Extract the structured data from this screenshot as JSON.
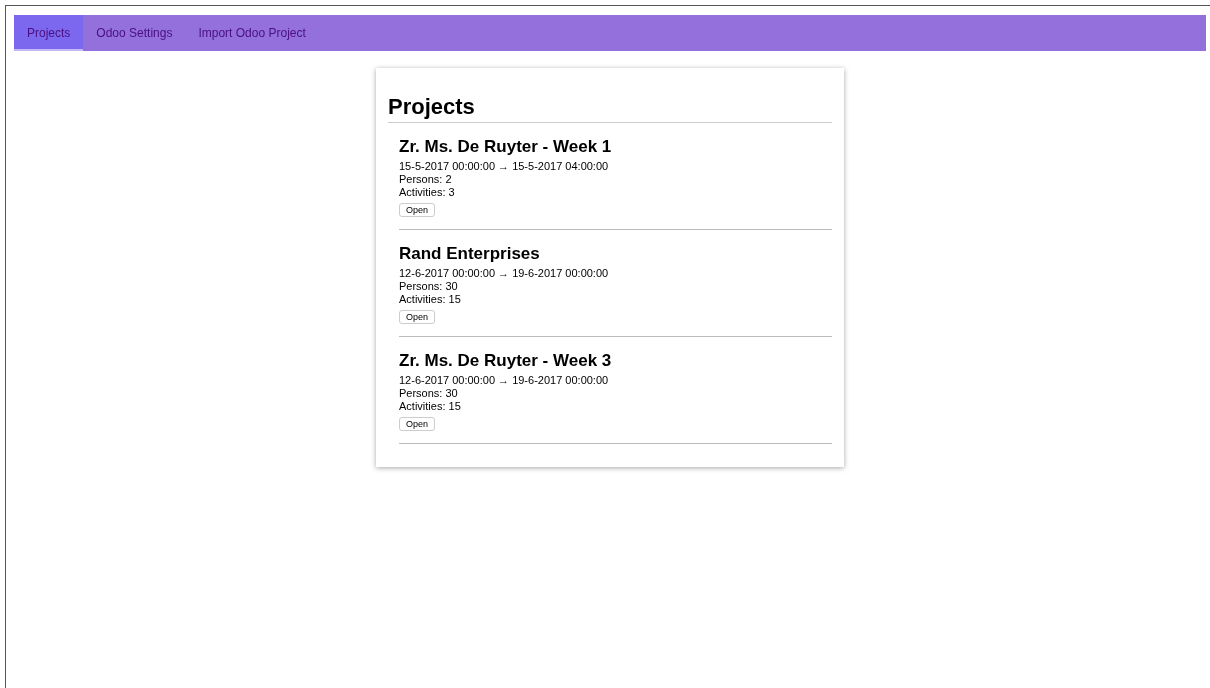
{
  "nav": {
    "tabs": [
      {
        "label": "Projects",
        "selected": true
      },
      {
        "label": "Odoo Settings",
        "selected": false
      },
      {
        "label": "Import Odoo Project",
        "selected": false
      }
    ]
  },
  "page": {
    "title": "Projects",
    "projects": [
      {
        "name": "Zr. Ms. De Ruyter - Week 1",
        "dates": "15-5-2017 00:00:00 → 15-5-2017 04:00:00",
        "persons": "Persons: 2",
        "activities": "Activities: 3",
        "button": "Open"
      },
      {
        "name": "Rand Enterprises",
        "dates": "12-6-2017 00:00:00 → 19-6-2017 00:00:00",
        "persons": "Persons: 30",
        "activities": "Activities: 15",
        "button": "Open"
      },
      {
        "name": "Zr. Ms. De Ruyter - Week 3",
        "dates": "12-6-2017 00:00:00 → 19-6-2017 00:00:00",
        "persons": "Persons: 30",
        "activities": "Activities: 15",
        "button": "Open"
      }
    ]
  }
}
